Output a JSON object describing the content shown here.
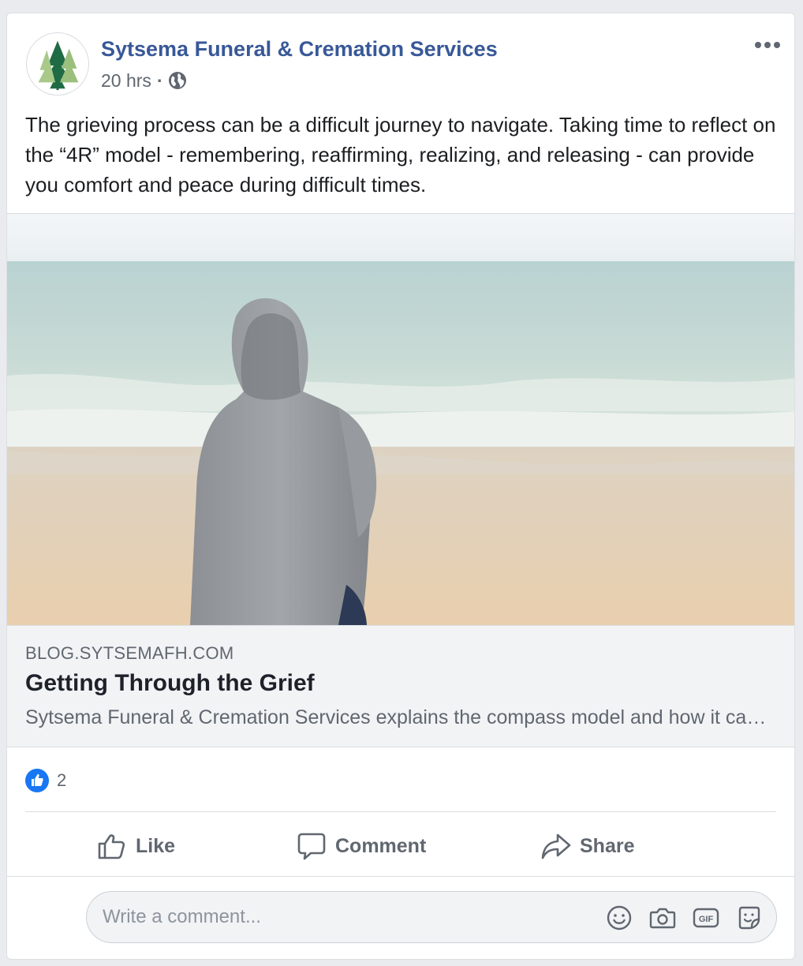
{
  "post": {
    "page_name": "Sytsema Funeral & Cremation Services",
    "timestamp": "20 hrs",
    "separator": "·",
    "audience_icon": "globe-icon",
    "text": "The grieving process can be a difficult journey to navigate. Taking time to reflect on the “4R” model - remembering, reaffirming, realizing, and releasing - can provide you comfort and peace during difficult times."
  },
  "link": {
    "domain": "BLOG.SYTSEMAFH.COM",
    "title": "Getting Through the Grief",
    "description": "Sytsema Funeral & Cremation Services explains the compass model and how it can help you through grief."
  },
  "reactions": {
    "count": "2",
    "icon": "like-reaction-icon"
  },
  "actions": {
    "like": "Like",
    "comment": "Comment",
    "share": "Share"
  },
  "comment_box": {
    "placeholder": "Write a comment...",
    "icons": [
      "emoji-icon",
      "camera-icon",
      "gif-icon",
      "sticker-icon"
    ]
  },
  "colors": {
    "link_blue": "#385898",
    "like_blue": "#1877f2",
    "secondary_text": "#606770",
    "background": "#e9ebee"
  }
}
